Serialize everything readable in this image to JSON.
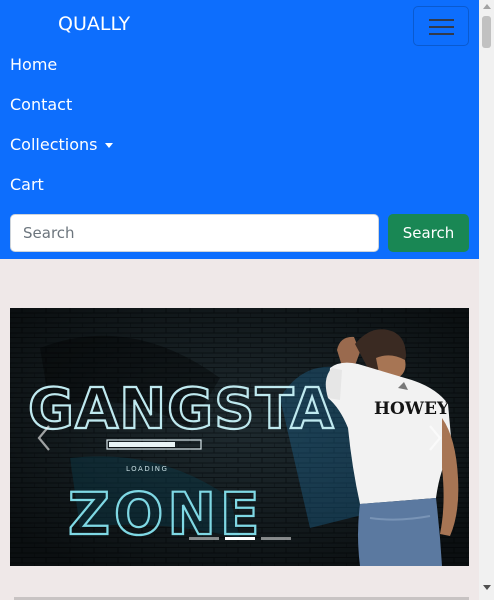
{
  "brand": "QUALLY",
  "nav": {
    "home": "Home",
    "contact": "Contact",
    "collections": "Collections",
    "cart": "Cart"
  },
  "search": {
    "placeholder": "Search",
    "button": "Search"
  },
  "carousel": {
    "slide_text": {
      "graffiti_top": "GANGSTA",
      "graffiti_bottom": "ZONE",
      "loading": "LOADING",
      "shirt": "HOWEY"
    },
    "slides": 3,
    "active_slide": 2
  },
  "colors": {
    "navbar": "#0d6efd",
    "search_button": "#198754",
    "page_background": "#efe8e8"
  }
}
